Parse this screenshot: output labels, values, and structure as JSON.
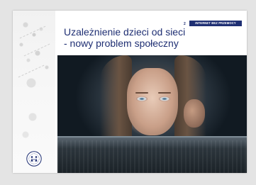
{
  "slide": {
    "page_number": "2",
    "banner_text": "INTERNET BEZ PRZEMOCY",
    "title_lines": [
      "Uzależnienie dzieci od sieci",
      "- nowy problem społeczny"
    ]
  },
  "colors": {
    "brand_navy": "#1f2f73",
    "background": "#e4e4e4"
  },
  "icons": {
    "logo": "children-circle-logo"
  }
}
